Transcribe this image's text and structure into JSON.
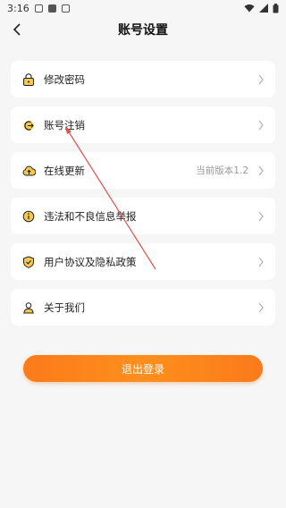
{
  "status_bar": {
    "time": "3:16"
  },
  "header": {
    "title": "账号设置"
  },
  "menu": [
    {
      "label": "修改密码",
      "icon": "lock-icon"
    },
    {
      "label": "账号注销",
      "icon": "logout-icon"
    },
    {
      "label": "在线更新",
      "icon": "cloud-upload-icon",
      "extra": "当前版本1.2"
    },
    {
      "label": "违法和不良信息举报",
      "icon": "info-icon"
    },
    {
      "label": "用户协议及隐私政策",
      "icon": "shield-icon"
    },
    {
      "label": "关于我们",
      "icon": "person-icon"
    }
  ],
  "logout_button": {
    "label": "退出登录"
  },
  "colors": {
    "accent": "#fb7f1b",
    "icon_yellow": "#f7c94a",
    "arrow": "#d9534f"
  }
}
